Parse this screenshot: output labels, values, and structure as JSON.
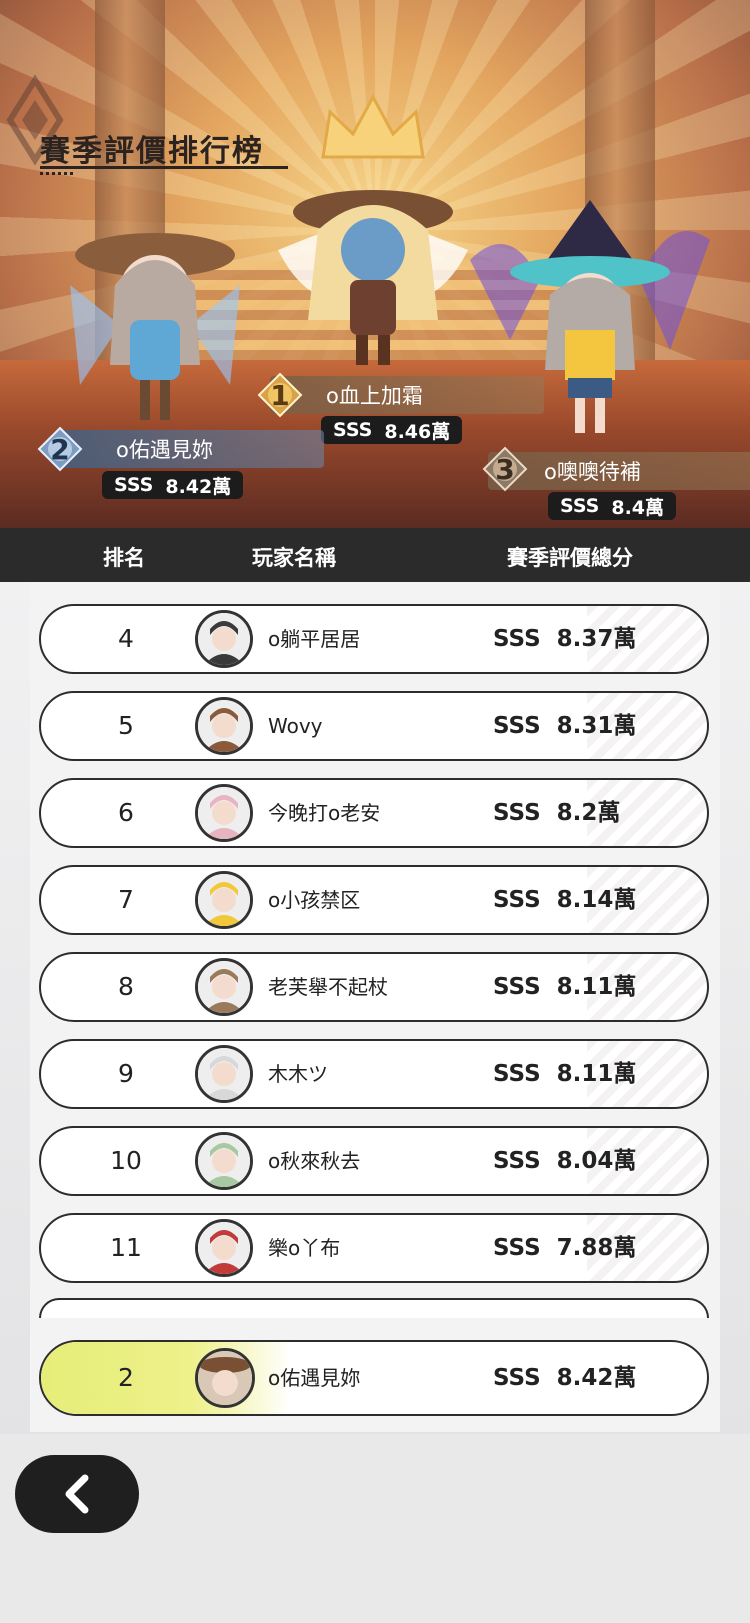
{
  "leaderboard": {
    "title": "賽季評價排行榜",
    "columns": {
      "rank": "排名",
      "player": "玩家名稱",
      "score": "賽季評價總分"
    }
  },
  "podium": [
    {
      "rank": "1",
      "name": "o血上加霜",
      "grade": "SSS",
      "score": "8.46萬"
    },
    {
      "rank": "2",
      "name": "o佑遇見妳",
      "grade": "SSS",
      "score": "8.42萬"
    },
    {
      "rank": "3",
      "name": "o噢噢待補",
      "grade": "SSS",
      "score": "8.4萬"
    }
  ],
  "rows": [
    {
      "rank": "4",
      "name": "o躺平居居",
      "grade": "SSS",
      "score": "8.37萬",
      "avatar_color": "#3a3a3a"
    },
    {
      "rank": "5",
      "name": "Wovy",
      "grade": "SSS",
      "score": "8.31萬",
      "avatar_color": "#8a5a3a"
    },
    {
      "rank": "6",
      "name": "今晚打o老安",
      "grade": "SSS",
      "score": "8.2萬",
      "avatar_color": "#e8b4c0"
    },
    {
      "rank": "7",
      "name": "o小孩禁区",
      "grade": "SSS",
      "score": "8.14萬",
      "avatar_color": "#f2c83a"
    },
    {
      "rank": "8",
      "name": "老芙舉不起杖",
      "grade": "SSS",
      "score": "8.11萬",
      "avatar_color": "#9a7a5a"
    },
    {
      "rank": "9",
      "name": "木木ツ",
      "grade": "SSS",
      "score": "8.11萬",
      "avatar_color": "#d8d8d8"
    },
    {
      "rank": "10",
      "name": "o秋來秋去",
      "grade": "SSS",
      "score": "8.04萬",
      "avatar_color": "#a7c8a0"
    },
    {
      "rank": "11",
      "name": "樂o丫布",
      "grade": "SSS",
      "score": "7.88萬",
      "avatar_color": "#c23a3a"
    }
  ],
  "self": {
    "rank": "2",
    "name": "o佑遇見妳",
    "grade": "SSS",
    "score": "8.42萬",
    "avatar_color": "#b98a68"
  },
  "colors": {
    "header_bg": "#2b2b2b",
    "self_glow": "#e6ee78",
    "gold": "#d8a24a",
    "silver": "#7d9cc0",
    "bronze": "#8c7a66"
  },
  "icons": {
    "back": "chevron-left-icon",
    "crown": "crown-icon"
  }
}
